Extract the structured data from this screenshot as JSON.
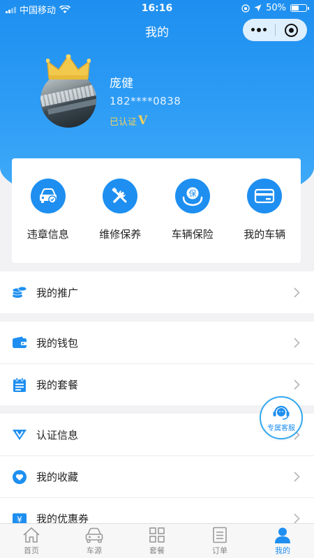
{
  "status_bar": {
    "carrier": "中国移动",
    "time": "16:16",
    "battery": "50%",
    "battery_level": 0.5
  },
  "nav": {
    "title": "我的"
  },
  "profile": {
    "name": "庞健",
    "phone": "182****0838",
    "cert_text": "已认证",
    "cert_badge": "V",
    "crown_color": "#f2c94c"
  },
  "quick_actions": [
    {
      "label": "违章信息",
      "icon": "car-violation-icon"
    },
    {
      "label": "维修保养",
      "icon": "tools-icon"
    },
    {
      "label": "车辆保险",
      "icon": "insurance-icon",
      "glyph": "保"
    },
    {
      "label": "我的车辆",
      "icon": "vehicle-card-icon"
    }
  ],
  "menu_groups": [
    [
      {
        "label": "我的推广",
        "icon": "coins-icon"
      }
    ],
    [
      {
        "label": "我的钱包",
        "icon": "wallet-icon"
      },
      {
        "label": "我的套餐",
        "icon": "package-icon"
      }
    ],
    [
      {
        "label": "认证信息",
        "icon": "certification-icon"
      },
      {
        "label": "我的收藏",
        "icon": "heart-icon"
      },
      {
        "label": "我的优惠券",
        "icon": "coupon-icon",
        "glyph": "¥"
      }
    ]
  ],
  "customer_service": {
    "label": "专属客服"
  },
  "tabbar": [
    {
      "label": "首页",
      "icon": "home-icon",
      "active": false
    },
    {
      "label": "车源",
      "icon": "car-icon",
      "active": false
    },
    {
      "label": "套餐",
      "icon": "grid-icon",
      "active": false
    },
    {
      "label": "订单",
      "icon": "order-icon",
      "active": false
    },
    {
      "label": "我的",
      "icon": "user-icon",
      "active": true
    }
  ],
  "colors": {
    "primary": "#1e8ff0",
    "gold": "#f4d25a",
    "background": "#f2f2f4"
  }
}
